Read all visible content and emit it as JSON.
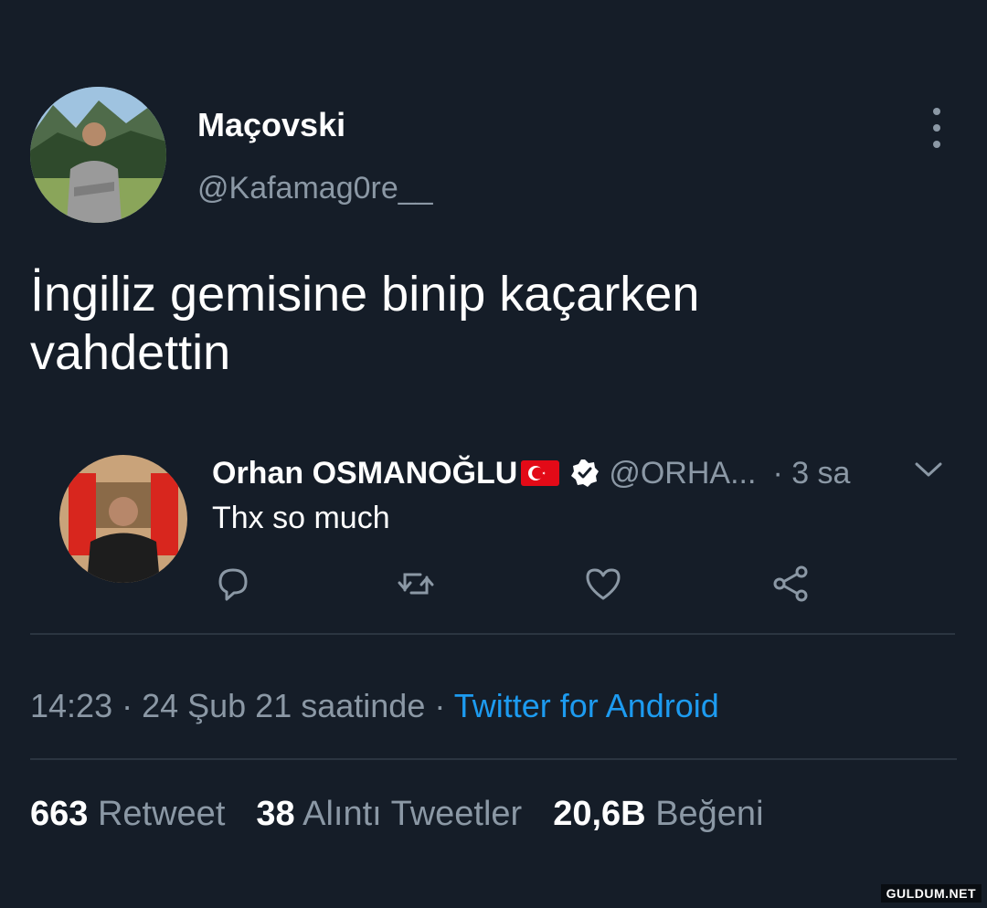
{
  "tweet": {
    "author": {
      "display_name": "Maçovski",
      "handle": "@Kafamag0re__"
    },
    "text_line1": "İngiliz gemisine binip kaçarken",
    "text_line2": "vahdettin",
    "more_icon": "more-vertical-icon"
  },
  "quoted": {
    "display_name": "Orhan OSMANOĞLU",
    "flag_icon": "turkey-flag-icon",
    "verified_icon": "verified-badge-icon",
    "handle": "@ORHA...",
    "time": "· 3 sa",
    "text": "Thx so much",
    "actions": [
      "reply-icon",
      "retweet-icon",
      "like-icon",
      "share-icon"
    ]
  },
  "meta": {
    "time_date": "14:23 · 24 Şub 21 saatinde · ",
    "source": "Twitter for Android"
  },
  "stats": [
    {
      "count": "663",
      "label": "Retweet"
    },
    {
      "count": "38",
      "label": "Alıntı Tweetler"
    },
    {
      "count": "20,6B",
      "label": "Beğeni"
    }
  ],
  "watermark": "GULDUM.NET",
  "colors": {
    "background": "#151d28",
    "muted": "#8b98a5",
    "link": "#1d9bf0",
    "flag_red": "#e30a17"
  }
}
